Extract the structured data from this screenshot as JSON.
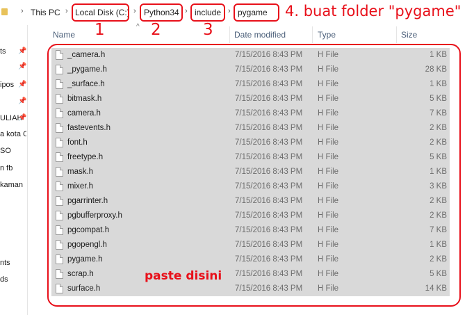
{
  "breadcrumb": {
    "items": [
      "This PC",
      "Local Disk (C:)",
      "Python34",
      "include",
      "pygame"
    ],
    "separator": "›"
  },
  "annotations": {
    "step1": "1",
    "step2": "2",
    "step3": "3",
    "step4": "4. buat folder \"pygame\"",
    "paste": "paste disini",
    "color": "#e8101a"
  },
  "sidebar": {
    "items": [
      "ts",
      "ipos",
      "ULIAH",
      "a kota C",
      "SO",
      "n fb",
      "kaman",
      "nts",
      "ds"
    ]
  },
  "columns": {
    "name": "Name",
    "date": "Date modified",
    "type": "Type",
    "size": "Size"
  },
  "files": [
    {
      "name": "_camera.h",
      "date": "7/15/2016 8:43 PM",
      "type": "H File",
      "size": "1 KB"
    },
    {
      "name": "_pygame.h",
      "date": "7/15/2016 8:43 PM",
      "type": "H File",
      "size": "28 KB"
    },
    {
      "name": "_surface.h",
      "date": "7/15/2016 8:43 PM",
      "type": "H File",
      "size": "1 KB"
    },
    {
      "name": "bitmask.h",
      "date": "7/15/2016 8:43 PM",
      "type": "H File",
      "size": "5 KB"
    },
    {
      "name": "camera.h",
      "date": "7/15/2016 8:43 PM",
      "type": "H File",
      "size": "7 KB"
    },
    {
      "name": "fastevents.h",
      "date": "7/15/2016 8:43 PM",
      "type": "H File",
      "size": "2 KB"
    },
    {
      "name": "font.h",
      "date": "7/15/2016 8:43 PM",
      "type": "H File",
      "size": "2 KB"
    },
    {
      "name": "freetype.h",
      "date": "7/15/2016 8:43 PM",
      "type": "H File",
      "size": "5 KB"
    },
    {
      "name": "mask.h",
      "date": "7/15/2016 8:43 PM",
      "type": "H File",
      "size": "1 KB"
    },
    {
      "name": "mixer.h",
      "date": "7/15/2016 8:43 PM",
      "type": "H File",
      "size": "3 KB"
    },
    {
      "name": "pgarrinter.h",
      "date": "7/15/2016 8:43 PM",
      "type": "H File",
      "size": "2 KB"
    },
    {
      "name": "pgbufferproxy.h",
      "date": "7/15/2016 8:43 PM",
      "type": "H File",
      "size": "2 KB"
    },
    {
      "name": "pgcompat.h",
      "date": "7/15/2016 8:43 PM",
      "type": "H File",
      "size": "7 KB"
    },
    {
      "name": "pgopengl.h",
      "date": "7/15/2016 8:43 PM",
      "type": "H File",
      "size": "1 KB"
    },
    {
      "name": "pygame.h",
      "date": "7/15/2016 8:43 PM",
      "type": "H File",
      "size": "2 KB"
    },
    {
      "name": "scrap.h",
      "date": "7/15/2016 8:43 PM",
      "type": "H File",
      "size": "5 KB"
    },
    {
      "name": "surface.h",
      "date": "7/15/2016 8:43 PM",
      "type": "H File",
      "size": "14 KB"
    }
  ]
}
